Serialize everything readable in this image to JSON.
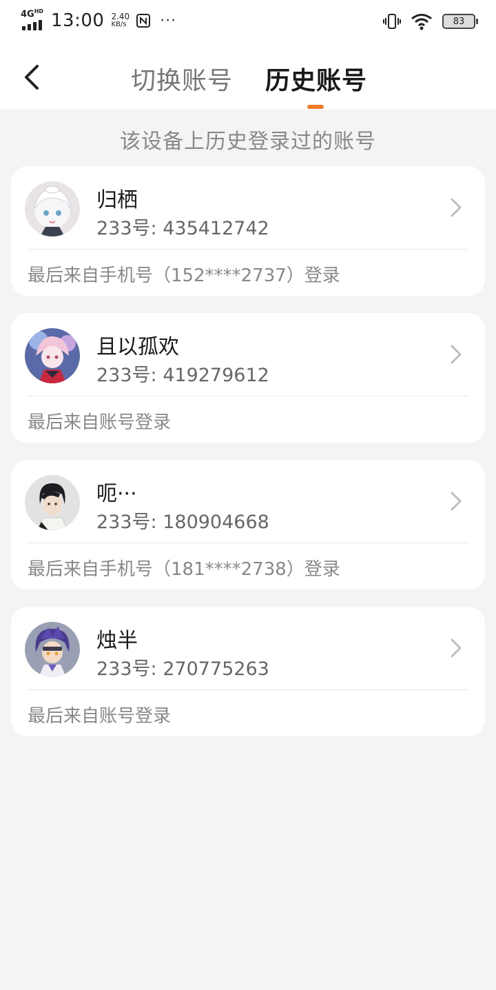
{
  "status_bar": {
    "network": "4G",
    "network_sup": "HD",
    "time": "13:00",
    "speed_value": "2.40",
    "speed_unit": "KB/s",
    "more": "···",
    "battery": "83"
  },
  "nav": {
    "tab_switch": "切换账号",
    "tab_history": "历史账号",
    "active_tab": "history",
    "accent_color": "#f27b2a"
  },
  "subtitle": "该设备上历史登录过的账号",
  "accounts": [
    {
      "name": "归栖",
      "id_text": "233号: 435412742",
      "login_info": "最后来自手机号（152****2737）登录",
      "avatar": "anime-white-hair-girl"
    },
    {
      "name": "且以孤欢",
      "id_text": "233号: 419279612",
      "login_info": "最后来自账号登录",
      "avatar": "anime-pink-hair-girl"
    },
    {
      "name": "呃···",
      "id_text": "233号: 180904668",
      "login_info": "最后来自手机号（181****2738）登录",
      "avatar": "anime-dark-hair-boy"
    },
    {
      "name": "烛半",
      "id_text": "233号: 270775263",
      "login_info": "最后来自账号登录",
      "avatar": "anime-purple-hair-boy"
    }
  ]
}
